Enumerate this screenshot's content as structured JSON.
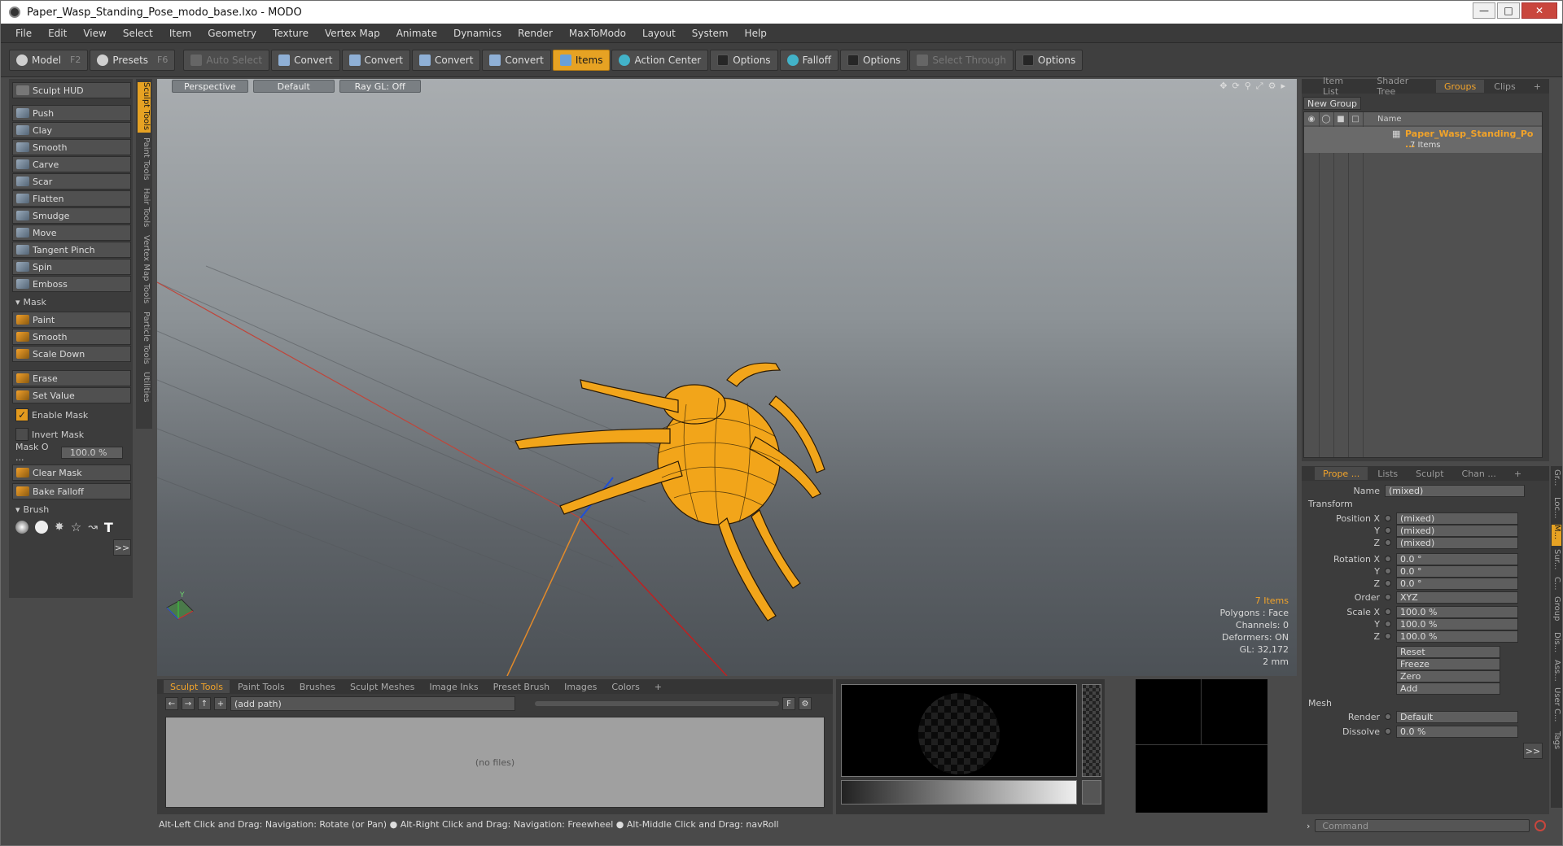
{
  "title": "Paper_Wasp_Standing_Pose_modo_base.lxo - MODO",
  "menu": [
    "File",
    "Edit",
    "View",
    "Select",
    "Item",
    "Geometry",
    "Texture",
    "Vertex Map",
    "Animate",
    "Dynamics",
    "Render",
    "MaxToModo",
    "Layout",
    "System",
    "Help"
  ],
  "toolbar": {
    "model": "Model",
    "model_key": "F2",
    "presets": "Presets",
    "presets_key": "F6",
    "auto_select": "Auto Select",
    "convert1": "Convert",
    "convert2": "Convert",
    "convert3": "Convert",
    "convert4": "Convert",
    "items": "Items",
    "action_center": "Action Center",
    "options1": "Options",
    "falloff": "Falloff",
    "options2": "Options",
    "select_through": "Select Through",
    "options3": "Options"
  },
  "sculpt": {
    "hud": "Sculpt HUD",
    "tools": [
      "Push",
      "Clay",
      "Smooth",
      "Carve",
      "Scar",
      "Flatten",
      "Smudge",
      "Move",
      "Tangent Pinch",
      "Spin",
      "Emboss"
    ],
    "mask_header": "Mask",
    "mask_tools": [
      "Paint",
      "Smooth",
      "Scale Down"
    ],
    "erase": "Erase",
    "set_value": "Set Value",
    "enable_mask": "Enable Mask",
    "invert_mask": "Invert Mask",
    "mask_opacity_label": "Mask O ...",
    "mask_opacity_value": "100.0 %",
    "clear_mask": "Clear Mask",
    "bake_falloff": "Bake Falloff",
    "brush_header": "Brush",
    "more": ">>"
  },
  "vtabs": [
    "Sculpt Tools",
    "Paint Tools",
    "Hair Tools",
    "Vertex Map Tools",
    "Particle Tools",
    "Utilities"
  ],
  "viewport": {
    "view": "Perspective",
    "shading": "Default",
    "raygl": "Ray GL: Off",
    "stats": {
      "items": "7 Items",
      "polygons": "Polygons : Face",
      "channels": "Channels: 0",
      "deformers": "Deformers: ON",
      "gl": "GL: 32,172",
      "scale": "2 mm"
    },
    "axis_label": "Y"
  },
  "bottom": {
    "tabs": [
      "Sculpt Tools",
      "Paint Tools",
      "Brushes",
      "Sculpt Meshes",
      "Image Inks",
      "Preset Brush",
      "Images",
      "Colors"
    ],
    "plus": "+",
    "path": "(add path)",
    "no_files": "(no files)",
    "f_label": "F"
  },
  "status": "Alt-Left Click and Drag: Navigation: Rotate (or Pan) ● Alt-Right Click and Drag: Navigation: Freewheel ● Alt-Middle Click and Drag: navRoll",
  "right": {
    "tabs": [
      "Item List",
      "Shader Tree",
      "Groups",
      "Clips"
    ],
    "plus": "+",
    "new_group": "New Group",
    "col_name": "Name",
    "group_name": "Paper_Wasp_Standing_Po ...",
    "group_count": "7 Items"
  },
  "props": {
    "tabs": [
      "Prope ...",
      "Lists",
      "Sculpt",
      "Chan ..."
    ],
    "plus": "+",
    "name_label": "Name",
    "name_value": "(mixed)",
    "transform": "Transform",
    "position_x_label": "Position X",
    "position_x": "(mixed)",
    "position_y_label": "Y",
    "position_y": "(mixed)",
    "position_z_label": "Z",
    "position_z": "(mixed)",
    "rotation_x_label": "Rotation X",
    "rotation_x": "0.0 °",
    "rotation_y_label": "Y",
    "rotation_y": "0.0 °",
    "rotation_z_label": "Z",
    "rotation_z": "0.0 °",
    "order_label": "Order",
    "order": "XYZ",
    "scale_x_label": "Scale X",
    "scale_x": "100.0 %",
    "scale_y_label": "Y",
    "scale_y": "100.0 %",
    "scale_z_label": "Z",
    "scale_z": "100.0 %",
    "reset": "Reset",
    "freeze": "Freeze",
    "zero": "Zero",
    "add": "Add",
    "mesh": "Mesh",
    "render_label": "Render",
    "render": "Default",
    "dissolve_label": "Dissolve",
    "dissolve": "0.0 %",
    "more": ">>",
    "command": "Command"
  },
  "rvtabs": [
    "Gr...",
    "Loc...",
    "M...",
    "Sur...",
    "C...",
    "Group",
    "Dis...",
    "Ass...",
    "User C...",
    "Tags"
  ]
}
